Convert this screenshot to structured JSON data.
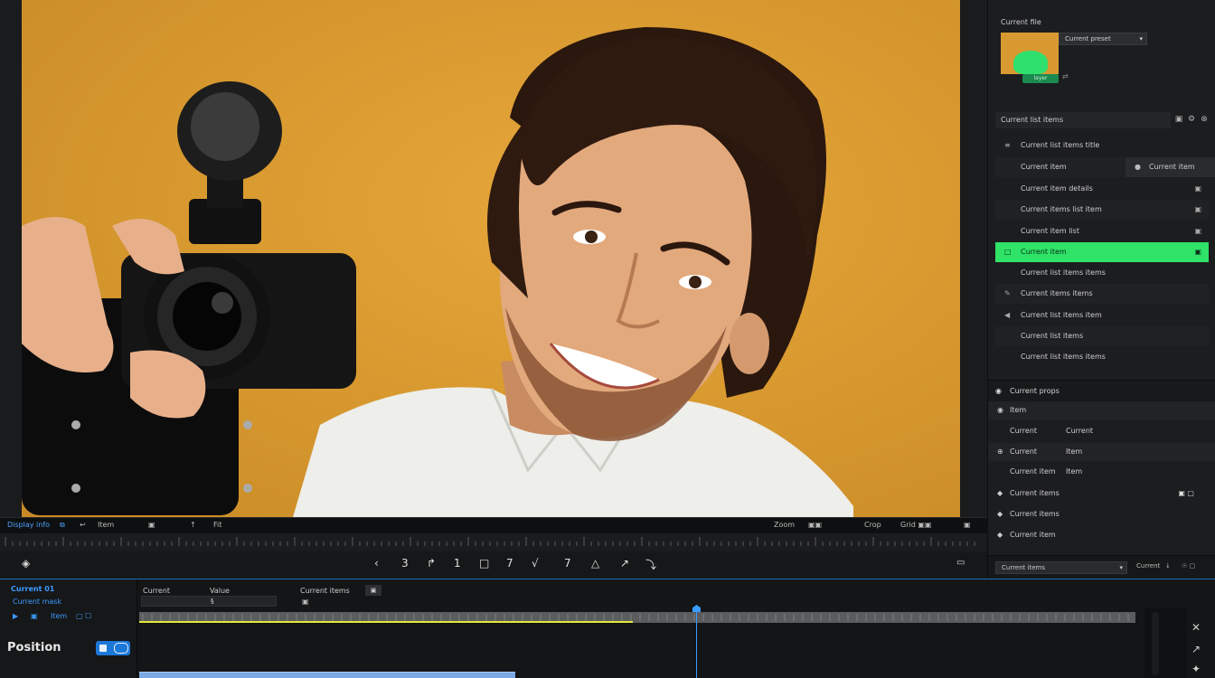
{
  "right_panel": {
    "title": "Current file",
    "preset": "Current preset",
    "thumb_tag": "layer",
    "thumb_link": "⇄",
    "search": "Current list items",
    "search_icons": [
      "▣",
      "⚙",
      "⊗"
    ],
    "layers": [
      {
        "label": "Current list items title",
        "icon": "≡",
        "right": ""
      },
      {
        "label": "Current item",
        "icon": "",
        "right": "",
        "tag": "Current item"
      },
      {
        "label": "Current item details",
        "icon": "",
        "right": "▣"
      },
      {
        "label": "Current items list item",
        "icon": "",
        "right": "▣"
      },
      {
        "label": "Current item list",
        "icon": "",
        "right": "▣"
      },
      {
        "label": "Current item",
        "icon": "□",
        "right": "▣"
      },
      {
        "label": "Current list items items",
        "icon": "",
        "right": ""
      },
      {
        "label": "Current items items",
        "icon": "✎",
        "right": ""
      },
      {
        "label": "Current list items item",
        "icon": "◀",
        "right": ""
      },
      {
        "label": "Current list items",
        "icon": "",
        "right": ""
      },
      {
        "label": "Current list items items",
        "icon": "",
        "right": ""
      }
    ],
    "props_title": "Current props",
    "props": [
      {
        "k": "Item",
        "v": "",
        "icon": "◉",
        "right": ""
      },
      {
        "k": "Current",
        "v": "Current",
        "icon": "",
        "right": ""
      },
      {
        "k": "Current",
        "v": "Item",
        "icon": "⊕",
        "right": ""
      },
      {
        "k": "Current item",
        "v": "Item",
        "icon": "",
        "right": ""
      },
      {
        "k": "Current items",
        "v": "",
        "icon": "◆",
        "right": "▣ ▢"
      },
      {
        "k": "Current items",
        "v": "",
        "icon": "◆",
        "right": ""
      },
      {
        "k": "Current item",
        "v": "",
        "icon": "◆",
        "right": ""
      }
    ],
    "footer_select": "Current items",
    "footer_items": [
      "Current",
      "↓",
      "☉ ▢"
    ]
  },
  "viewer_bar": {
    "left": [
      "Display info",
      "⧉",
      "↩",
      "Item",
      "▣",
      "↑",
      "Fit"
    ],
    "right": [
      "Zoom",
      "▣▣",
      "Crop",
      "Grid ▣▣",
      "▣"
    ]
  },
  "transport": {
    "left_icon": "◈",
    "buttons": [
      "‹",
      "3",
      "↱",
      "1",
      "□",
      "7",
      "√",
      "7",
      "△",
      "↗",
      "⤵"
    ],
    "right_icon": "▭"
  },
  "timeline": {
    "name": "Current 01",
    "sub": "Current mask",
    "icons": [
      "▶",
      "▣",
      "Item",
      "▢ ☐"
    ],
    "title": "Position",
    "headers": [
      "Current",
      "Value",
      "Current items",
      "▣"
    ],
    "field_value": "§",
    "sub_header": "▣",
    "right_icons": [
      "✕",
      "↗",
      "✦"
    ]
  },
  "colors": {
    "accent_blue": "#3b9bff",
    "selection_green": "#2ee368",
    "work_area": "#e4e832",
    "backdrop": "#d99a30"
  }
}
